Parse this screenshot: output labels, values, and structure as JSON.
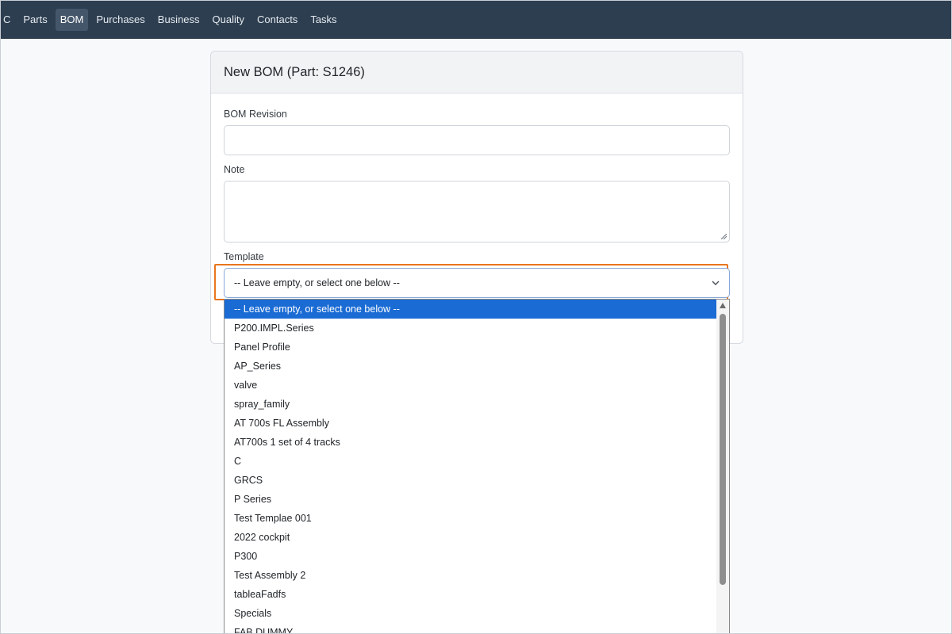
{
  "nav": {
    "items": [
      "C",
      "Parts",
      "BOM",
      "Purchases",
      "Business",
      "Quality",
      "Contacts",
      "Tasks"
    ],
    "active": "BOM"
  },
  "form": {
    "title": "New BOM (Part: S1246)",
    "bom_revision_label": "BOM Revision",
    "bom_revision_value": "",
    "note_label": "Note",
    "note_value": "",
    "template_label": "Template",
    "template_selected": "-- Leave empty, or select one below --"
  },
  "dropdown": {
    "options": [
      "-- Leave empty, or select one below --",
      "P200.IMPL.Series",
      "Panel Profile",
      "AP_Series",
      "valve",
      "spray_family",
      "AT 700s FL Assembly",
      "AT700s 1 set of 4 tracks",
      "C",
      "GRCS",
      "P Series",
      "Test Templae 001",
      "2022 cockpit",
      "P300",
      "Test Assembly 2",
      "tableaFadfs",
      "Specials",
      "FAB DUMMY"
    ],
    "highlighted_index": 0
  },
  "colors": {
    "navbar": "#2d3e50",
    "highlight": "#1a6bd4",
    "focus_ring": "#e8761e"
  }
}
